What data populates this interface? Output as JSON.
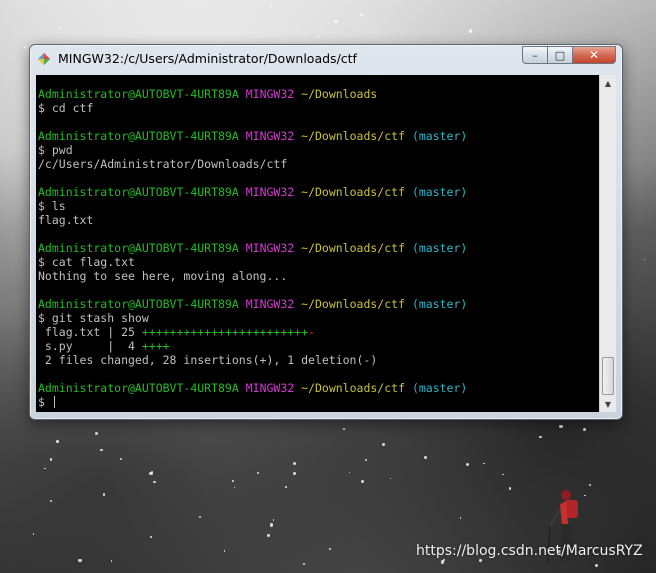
{
  "window": {
    "title": "MINGW32:/c/Users/Administrator/Downloads/ctf",
    "controls": {
      "minimize": "–",
      "maximize": "□",
      "close": "✕"
    }
  },
  "terminal": {
    "colors": {
      "user": "#25bc24",
      "system": "#d338d3",
      "path": "#c7c43c",
      "branch": "#2bb5c6",
      "text": "#c0c0c0",
      "insertions": "#25bc24",
      "deletions": "#c8343a"
    },
    "lines": [
      {
        "user": "Administrator@AUTOBVT-4URT89A",
        "system": "MINGW32",
        "path": "~/Downloads",
        "branch": ""
      },
      {
        "text": "$ cd ctf"
      },
      {
        "text": ""
      },
      {
        "user": "Administrator@AUTOBVT-4URT89A",
        "system": "MINGW32",
        "path": "~/Downloads/ctf",
        "branch": "(master)"
      },
      {
        "text": "$ pwd"
      },
      {
        "text": "/c/Users/Administrator/Downloads/ctf"
      },
      {
        "text": ""
      },
      {
        "user": "Administrator@AUTOBVT-4URT89A",
        "system": "MINGW32",
        "path": "~/Downloads/ctf",
        "branch": "(master)"
      },
      {
        "text": "$ ls"
      },
      {
        "text": "flag.txt"
      },
      {
        "text": ""
      },
      {
        "user": "Administrator@AUTOBVT-4URT89A",
        "system": "MINGW32",
        "path": "~/Downloads/ctf",
        "branch": "(master)"
      },
      {
        "text": "$ cat flag.txt"
      },
      {
        "text": "Nothing to see here, moving along..."
      },
      {
        "text": ""
      },
      {
        "user": "Administrator@AUTOBVT-4URT89A",
        "system": "MINGW32",
        "path": "~/Downloads/ctf",
        "branch": "(master)"
      },
      {
        "text": "$ git stash show"
      },
      {
        "text": " flag.txt | 25 ",
        "plus": "++++++++++++++++++++++++",
        "minus": "-"
      },
      {
        "text": " s.py     |  4 ",
        "plus": "++++",
        "minus": ""
      },
      {
        "text": " 2 files changed, 28 insertions(+), 1 deletion(-)"
      },
      {
        "text": ""
      },
      {
        "user": "Administrator@AUTOBVT-4URT89A",
        "system": "MINGW32",
        "path": "~/Downloads/ctf",
        "branch": "(master)"
      },
      {
        "text": "$ ",
        "cursor": true
      }
    ]
  },
  "scrollbar": {
    "up": "▲",
    "down": "▼"
  },
  "watermark": "https://blog.csdn.net/MarcusRYZ"
}
